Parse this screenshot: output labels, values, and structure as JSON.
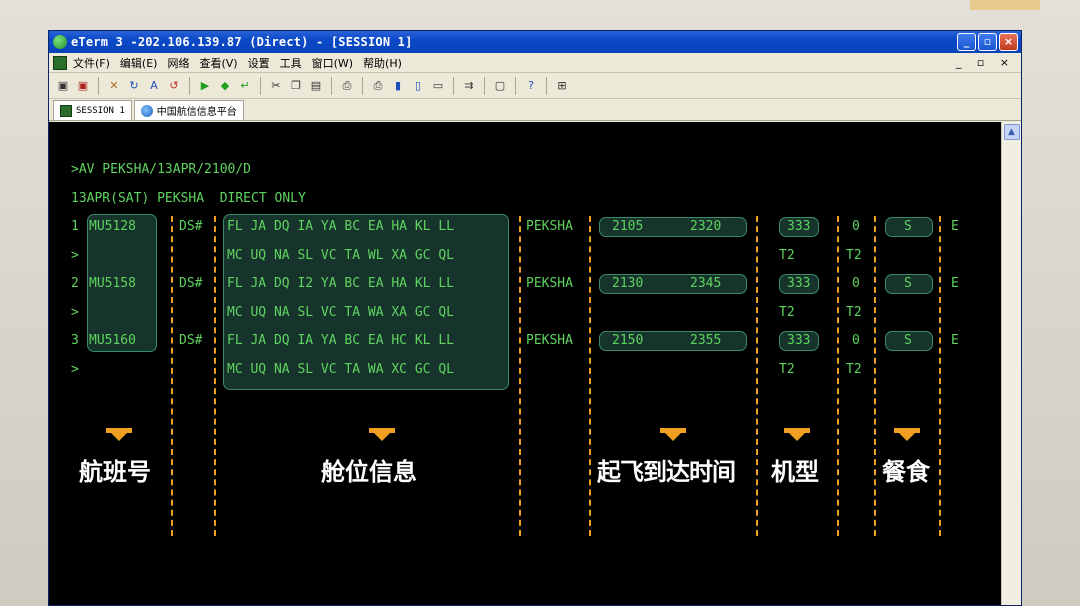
{
  "window": {
    "title": "eTerm 3 -202.106.139.87 (Direct) - [SESSION 1]",
    "controls": [
      "minimize",
      "restore",
      "close"
    ]
  },
  "menu": {
    "items": [
      "文件(F)",
      "编辑(E)",
      "网络",
      "查看(V)",
      "设置",
      "工具",
      "窗口(W)",
      "帮助(H)"
    ],
    "mdi_controls": "_ ▫ ×"
  },
  "tabs": [
    {
      "label": "SESSION 1",
      "icon": "session-icon"
    },
    {
      "label": "中国航信信息平台",
      "icon": "globe-icon"
    }
  ],
  "terminal": {
    "command": ">AV PEKSHA/13APR/2100/D",
    "header": "13APR(SAT) PEKSHA  DIRECT ONLY",
    "flights": [
      {
        "index": "1",
        "flight": "MU5128",
        "ds": "DS#",
        "classes1": "FL JA DQ IA YA BC EA HA KL LL",
        "classes2": "MC UQ NA SL VC TA WL XA GC QL",
        "route": "PEKSHA",
        "dep": "2105",
        "arr": "2320",
        "aircraft": "333",
        "stops": "0",
        "meal": "S",
        "eticket": "E",
        "terminal_dep": "T2",
        "terminal_arr": "T2"
      },
      {
        "index": "2",
        "flight": "MU5158",
        "ds": "DS#",
        "classes1": "FL JA DQ I2 YA BC EA HA KL LL",
        "classes2": "MC UQ NA SL VC TA WA XA GC QL",
        "route": "PEKSHA",
        "dep": "2130",
        "arr": "2345",
        "aircraft": "333",
        "stops": "0",
        "meal": "S",
        "eticket": "E",
        "terminal_dep": "T2",
        "terminal_arr": "T2"
      },
      {
        "index": "3",
        "flight": "MU5160",
        "ds": "DS#",
        "classes1": "FL JA DQ IA YA BC EA HC KL LL",
        "classes2": "MC UQ NA SL VC TA WA XC GC QL",
        "route": "PEKSHA",
        "dep": "2150",
        "arr": "2355",
        "aircraft": "333",
        "stops": "0",
        "meal": "S",
        "eticket": "E",
        "terminal_dep": "T2",
        "terminal_arr": "T2"
      }
    ],
    "continuation": ">"
  },
  "annotations": {
    "flight_number": "航班号",
    "cabin_info": "舱位信息",
    "times": "起飞到达时间",
    "aircraft": "机型",
    "meal": "餐食"
  },
  "colors": {
    "terminal_bg": "#000000",
    "terminal_text": "#5fd35f",
    "highlight_fill": "#285f50",
    "divider": "#f0a020",
    "caption": "#ffffff"
  }
}
